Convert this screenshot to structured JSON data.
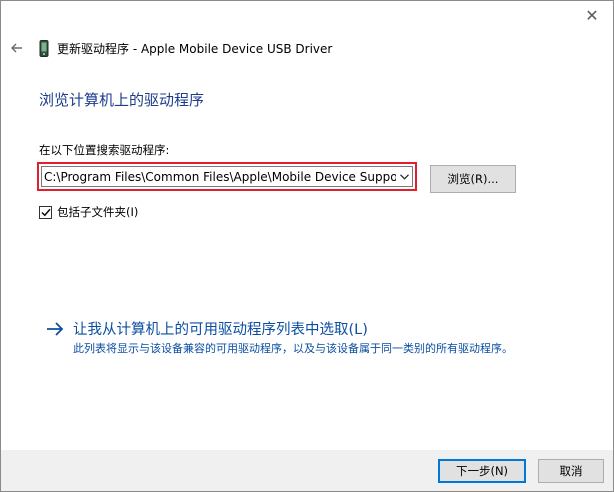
{
  "dialog": {
    "close_glyph": "✕",
    "title": "更新驱动程序 - Apple Mobile Device USB Driver",
    "heading": "浏览计算机上的驱动程序"
  },
  "search": {
    "label": "在以下位置搜索驱动程序:",
    "path_value": "C:\\Program Files\\Common Files\\Apple\\Mobile Device Support",
    "browse_label": "浏览(R)..."
  },
  "options": {
    "include_subfolders_label": "包括子文件夹(I)",
    "include_subfolders_checked": true
  },
  "pick": {
    "link_text": "让我从计算机上的可用驱动程序列表中选取(L)",
    "description": "此列表将显示与该设备兼容的可用驱动程序，以及与该设备属于同一类别的所有驱动程序。"
  },
  "buttons": {
    "next": "下一步(N)",
    "cancel": "取消"
  },
  "colors": {
    "heading": "#1c3c8c",
    "link": "#0b4ea2",
    "highlight_border": "#e0202c",
    "default_button_border": "#0078d7"
  },
  "icons": {
    "back": "back-arrow-icon",
    "device": "mobile-device-icon",
    "dropdown": "chevron-down-icon",
    "check": "checkmark-icon",
    "link_arrow": "right-arrow-icon"
  }
}
